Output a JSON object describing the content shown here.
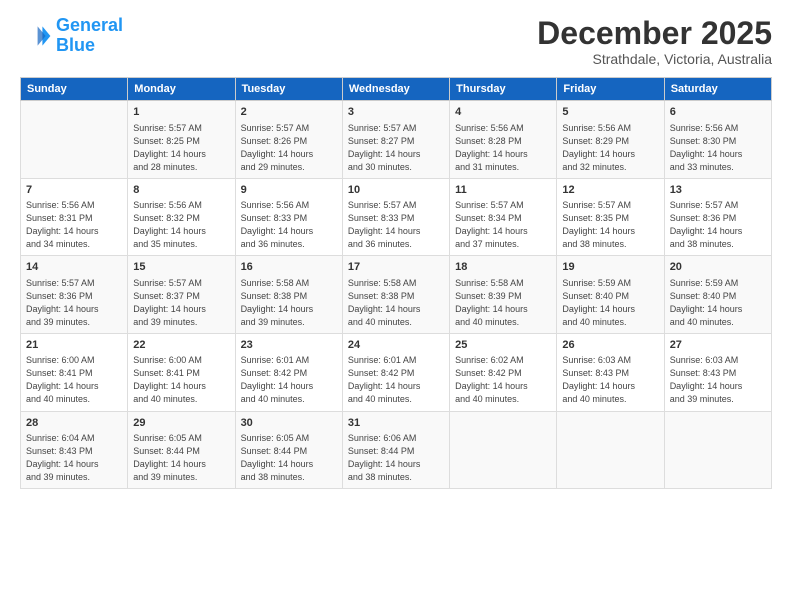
{
  "header": {
    "logo_line1": "General",
    "logo_line2": "Blue",
    "title": "December 2025",
    "subtitle": "Strathdale, Victoria, Australia"
  },
  "days_header": [
    "Sunday",
    "Monday",
    "Tuesday",
    "Wednesday",
    "Thursday",
    "Friday",
    "Saturday"
  ],
  "weeks": [
    [
      {
        "day": "",
        "lines": []
      },
      {
        "day": "1",
        "lines": [
          "Sunrise: 5:57 AM",
          "Sunset: 8:25 PM",
          "Daylight: 14 hours",
          "and 28 minutes."
        ]
      },
      {
        "day": "2",
        "lines": [
          "Sunrise: 5:57 AM",
          "Sunset: 8:26 PM",
          "Daylight: 14 hours",
          "and 29 minutes."
        ]
      },
      {
        "day": "3",
        "lines": [
          "Sunrise: 5:57 AM",
          "Sunset: 8:27 PM",
          "Daylight: 14 hours",
          "and 30 minutes."
        ]
      },
      {
        "day": "4",
        "lines": [
          "Sunrise: 5:56 AM",
          "Sunset: 8:28 PM",
          "Daylight: 14 hours",
          "and 31 minutes."
        ]
      },
      {
        "day": "5",
        "lines": [
          "Sunrise: 5:56 AM",
          "Sunset: 8:29 PM",
          "Daylight: 14 hours",
          "and 32 minutes."
        ]
      },
      {
        "day": "6",
        "lines": [
          "Sunrise: 5:56 AM",
          "Sunset: 8:30 PM",
          "Daylight: 14 hours",
          "and 33 minutes."
        ]
      }
    ],
    [
      {
        "day": "7",
        "lines": [
          "Sunrise: 5:56 AM",
          "Sunset: 8:31 PM",
          "Daylight: 14 hours",
          "and 34 minutes."
        ]
      },
      {
        "day": "8",
        "lines": [
          "Sunrise: 5:56 AM",
          "Sunset: 8:32 PM",
          "Daylight: 14 hours",
          "and 35 minutes."
        ]
      },
      {
        "day": "9",
        "lines": [
          "Sunrise: 5:56 AM",
          "Sunset: 8:33 PM",
          "Daylight: 14 hours",
          "and 36 minutes."
        ]
      },
      {
        "day": "10",
        "lines": [
          "Sunrise: 5:57 AM",
          "Sunset: 8:33 PM",
          "Daylight: 14 hours",
          "and 36 minutes."
        ]
      },
      {
        "day": "11",
        "lines": [
          "Sunrise: 5:57 AM",
          "Sunset: 8:34 PM",
          "Daylight: 14 hours",
          "and 37 minutes."
        ]
      },
      {
        "day": "12",
        "lines": [
          "Sunrise: 5:57 AM",
          "Sunset: 8:35 PM",
          "Daylight: 14 hours",
          "and 38 minutes."
        ]
      },
      {
        "day": "13",
        "lines": [
          "Sunrise: 5:57 AM",
          "Sunset: 8:36 PM",
          "Daylight: 14 hours",
          "and 38 minutes."
        ]
      }
    ],
    [
      {
        "day": "14",
        "lines": [
          "Sunrise: 5:57 AM",
          "Sunset: 8:36 PM",
          "Daylight: 14 hours",
          "and 39 minutes."
        ]
      },
      {
        "day": "15",
        "lines": [
          "Sunrise: 5:57 AM",
          "Sunset: 8:37 PM",
          "Daylight: 14 hours",
          "and 39 minutes."
        ]
      },
      {
        "day": "16",
        "lines": [
          "Sunrise: 5:58 AM",
          "Sunset: 8:38 PM",
          "Daylight: 14 hours",
          "and 39 minutes."
        ]
      },
      {
        "day": "17",
        "lines": [
          "Sunrise: 5:58 AM",
          "Sunset: 8:38 PM",
          "Daylight: 14 hours",
          "and 40 minutes."
        ]
      },
      {
        "day": "18",
        "lines": [
          "Sunrise: 5:58 AM",
          "Sunset: 8:39 PM",
          "Daylight: 14 hours",
          "and 40 minutes."
        ]
      },
      {
        "day": "19",
        "lines": [
          "Sunrise: 5:59 AM",
          "Sunset: 8:40 PM",
          "Daylight: 14 hours",
          "and 40 minutes."
        ]
      },
      {
        "day": "20",
        "lines": [
          "Sunrise: 5:59 AM",
          "Sunset: 8:40 PM",
          "Daylight: 14 hours",
          "and 40 minutes."
        ]
      }
    ],
    [
      {
        "day": "21",
        "lines": [
          "Sunrise: 6:00 AM",
          "Sunset: 8:41 PM",
          "Daylight: 14 hours",
          "and 40 minutes."
        ]
      },
      {
        "day": "22",
        "lines": [
          "Sunrise: 6:00 AM",
          "Sunset: 8:41 PM",
          "Daylight: 14 hours",
          "and 40 minutes."
        ]
      },
      {
        "day": "23",
        "lines": [
          "Sunrise: 6:01 AM",
          "Sunset: 8:42 PM",
          "Daylight: 14 hours",
          "and 40 minutes."
        ]
      },
      {
        "day": "24",
        "lines": [
          "Sunrise: 6:01 AM",
          "Sunset: 8:42 PM",
          "Daylight: 14 hours",
          "and 40 minutes."
        ]
      },
      {
        "day": "25",
        "lines": [
          "Sunrise: 6:02 AM",
          "Sunset: 8:42 PM",
          "Daylight: 14 hours",
          "and 40 minutes."
        ]
      },
      {
        "day": "26",
        "lines": [
          "Sunrise: 6:03 AM",
          "Sunset: 8:43 PM",
          "Daylight: 14 hours",
          "and 40 minutes."
        ]
      },
      {
        "day": "27",
        "lines": [
          "Sunrise: 6:03 AM",
          "Sunset: 8:43 PM",
          "Daylight: 14 hours",
          "and 39 minutes."
        ]
      }
    ],
    [
      {
        "day": "28",
        "lines": [
          "Sunrise: 6:04 AM",
          "Sunset: 8:43 PM",
          "Daylight: 14 hours",
          "and 39 minutes."
        ]
      },
      {
        "day": "29",
        "lines": [
          "Sunrise: 6:05 AM",
          "Sunset: 8:44 PM",
          "Daylight: 14 hours",
          "and 39 minutes."
        ]
      },
      {
        "day": "30",
        "lines": [
          "Sunrise: 6:05 AM",
          "Sunset: 8:44 PM",
          "Daylight: 14 hours",
          "and 38 minutes."
        ]
      },
      {
        "day": "31",
        "lines": [
          "Sunrise: 6:06 AM",
          "Sunset: 8:44 PM",
          "Daylight: 14 hours",
          "and 38 minutes."
        ]
      },
      {
        "day": "",
        "lines": []
      },
      {
        "day": "",
        "lines": []
      },
      {
        "day": "",
        "lines": []
      }
    ]
  ]
}
